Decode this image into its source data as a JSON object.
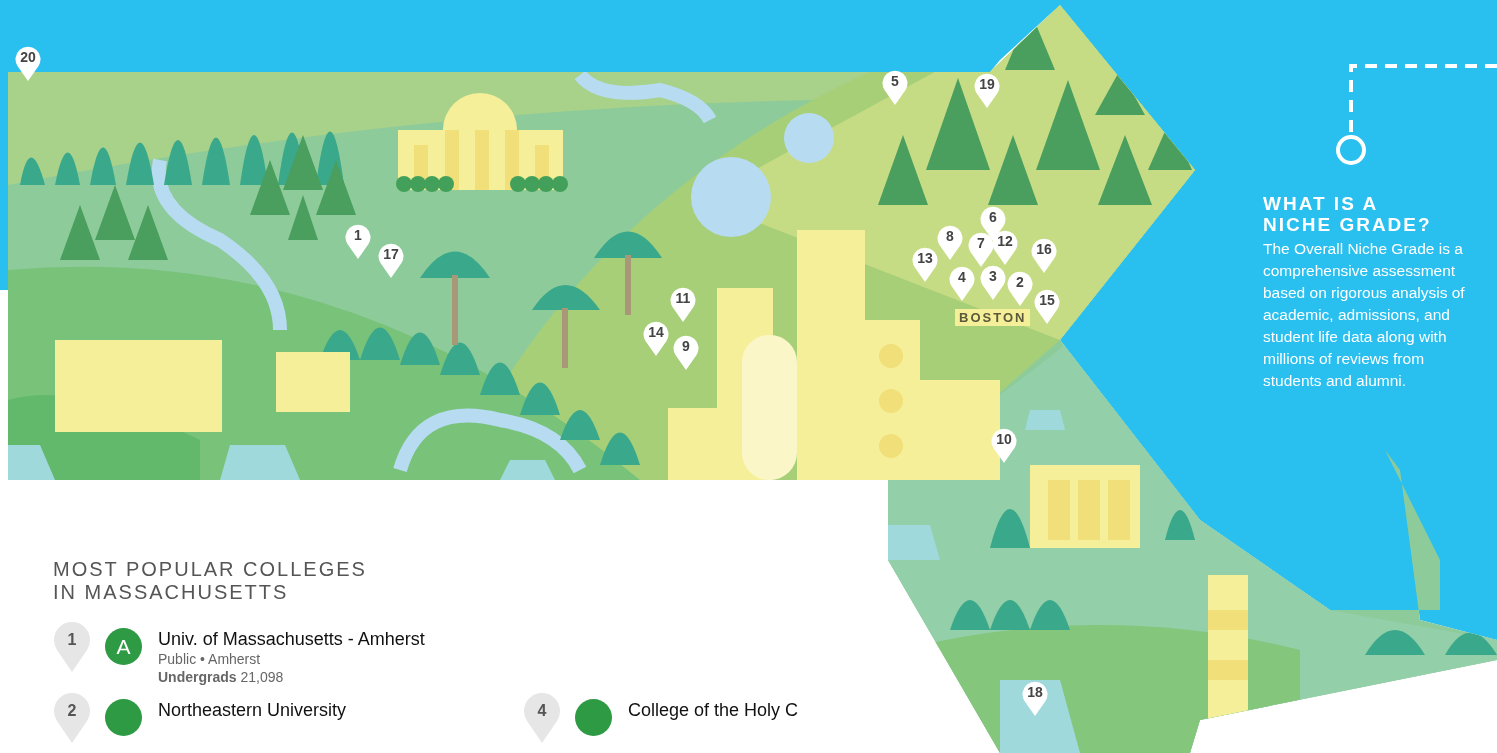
{
  "map": {
    "pins": [
      {
        "label": "20"
      },
      {
        "label": "5"
      },
      {
        "label": "19"
      },
      {
        "label": "6"
      },
      {
        "label": "8"
      },
      {
        "label": "7"
      },
      {
        "label": "12"
      },
      {
        "label": "16"
      },
      {
        "label": "1"
      },
      {
        "label": "13"
      },
      {
        "label": "17"
      },
      {
        "label": "4"
      },
      {
        "label": "3"
      },
      {
        "label": "2"
      },
      {
        "label": "11"
      },
      {
        "label": "15"
      },
      {
        "label": "14"
      },
      {
        "label": "9"
      },
      {
        "label": "10"
      },
      {
        "label": "18"
      }
    ],
    "city_label": "BOSTON"
  },
  "info": {
    "title": "WHAT IS A NICHE GRADE?",
    "body": "The Overall Niche Grade is a comprehensive assessment based on rigorous analysis of academic, admissions, and student life data along with millions of reviews from students and alumni."
  },
  "list": {
    "title": "MOST POPULAR COLLEGES IN MASSACHUSETTS",
    "colleges": [
      {
        "rank": "1",
        "grade": "A",
        "name": "Univ. of Massachusetts - Amherst",
        "meta": "Public • Amherst",
        "undergrads_label": "Undergrads",
        "undergrads": "21,098"
      },
      {
        "rank": "2",
        "name": "Northeastern University"
      },
      {
        "rank": "4",
        "name": "College of the Holy C"
      }
    ]
  }
}
